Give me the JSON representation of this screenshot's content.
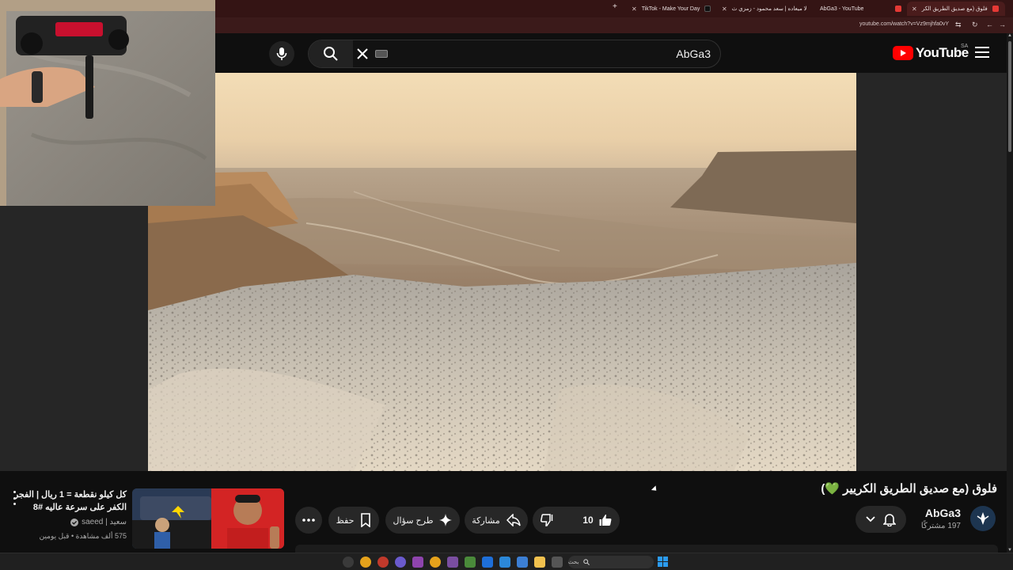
{
  "browser": {
    "tabs": [
      {
        "label": "TikTok - Make Your Day",
        "color": "#111111"
      },
      {
        "label": "لا ميعاده | سعد محمود - زمزي ث",
        "color": "#e53935"
      },
      {
        "label": "AbGa3 - YouTube",
        "color": "#e53935"
      },
      {
        "label": "فلوق (مع صديق الطريق الكر",
        "color": "#e53935"
      }
    ],
    "new_tab": "+",
    "url": "youtube.com/watch?v=Vz9mjhfa0vY"
  },
  "header": {
    "search_query": "AbGa3",
    "logo_text": "YouTube",
    "region": "SA"
  },
  "video": {
    "title": "فلوق (مع صديق الطريق الكريير 💚)",
    "channel": "AbGa3",
    "subscribers": "197 مشتركًا",
    "likes": "10",
    "share_label": "مشاركة",
    "ask_label": "طرح سؤال",
    "save_label": "حفظ"
  },
  "recommended": {
    "title": "كل كيلو نقطعة = 1 ريال | الفجر الكفر على سرعة عاليه #8",
    "channel": "سعيد | saeed",
    "meta": "575 ألف مشاهدة • قبل يومين"
  },
  "taskbar": {
    "search_placeholder": "بحث"
  },
  "colors": {
    "youtube_red": "#ff0000",
    "background": "#0f0f0f",
    "pill": "#272727",
    "tabstrip": "#341414"
  }
}
